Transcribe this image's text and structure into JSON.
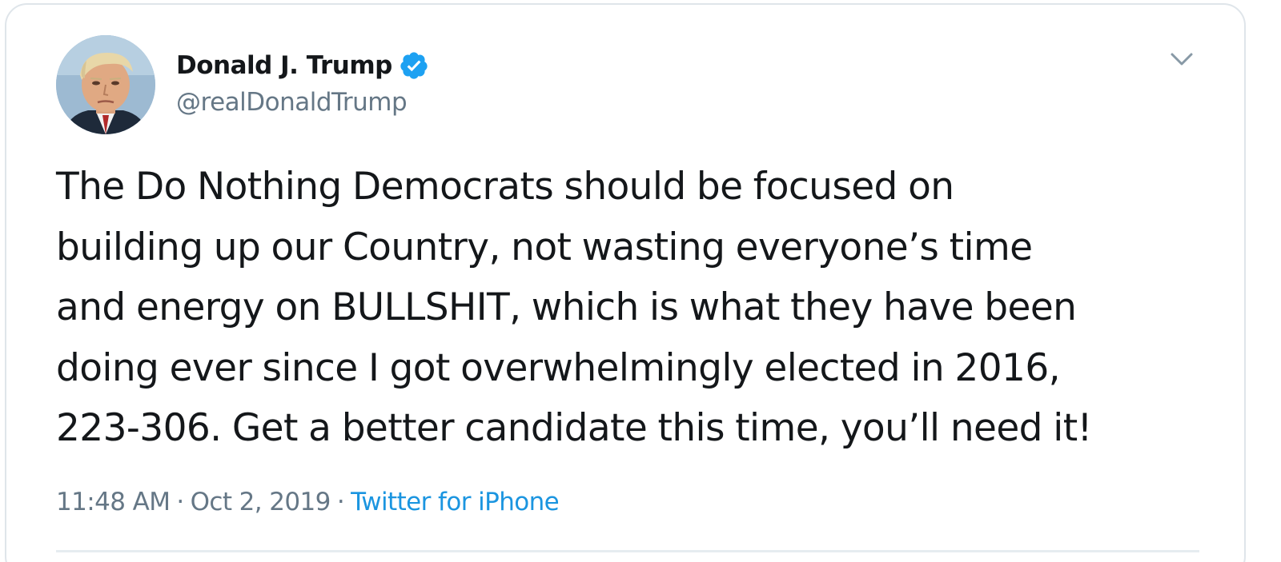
{
  "tweet": {
    "display_name": "Donald J. Trump",
    "handle": "@realDonaldTrump",
    "verified": true,
    "text_lines": [
      "The Do Nothing Democrats should be focused on",
      "building up our Country, not wasting everyone’s time",
      "and energy on BULLSHIT, which is what they have been",
      "doing ever since I got overwhelmingly elected in 2016,",
      "223-306. Get a better candidate this time, you’ll need it!"
    ],
    "time": "11:48 AM",
    "separator": "·",
    "date": "Oct 2, 2019",
    "source": "Twitter for iPhone"
  },
  "icons": {
    "verified": "verified-badge-icon",
    "more": "chevron-down-icon",
    "avatar": "profile-photo"
  },
  "colors": {
    "name": "#14171a",
    "secondary": "#657786",
    "link": "#1b95e0",
    "verified": "#1da1f2",
    "border": "#dfe5ea"
  }
}
